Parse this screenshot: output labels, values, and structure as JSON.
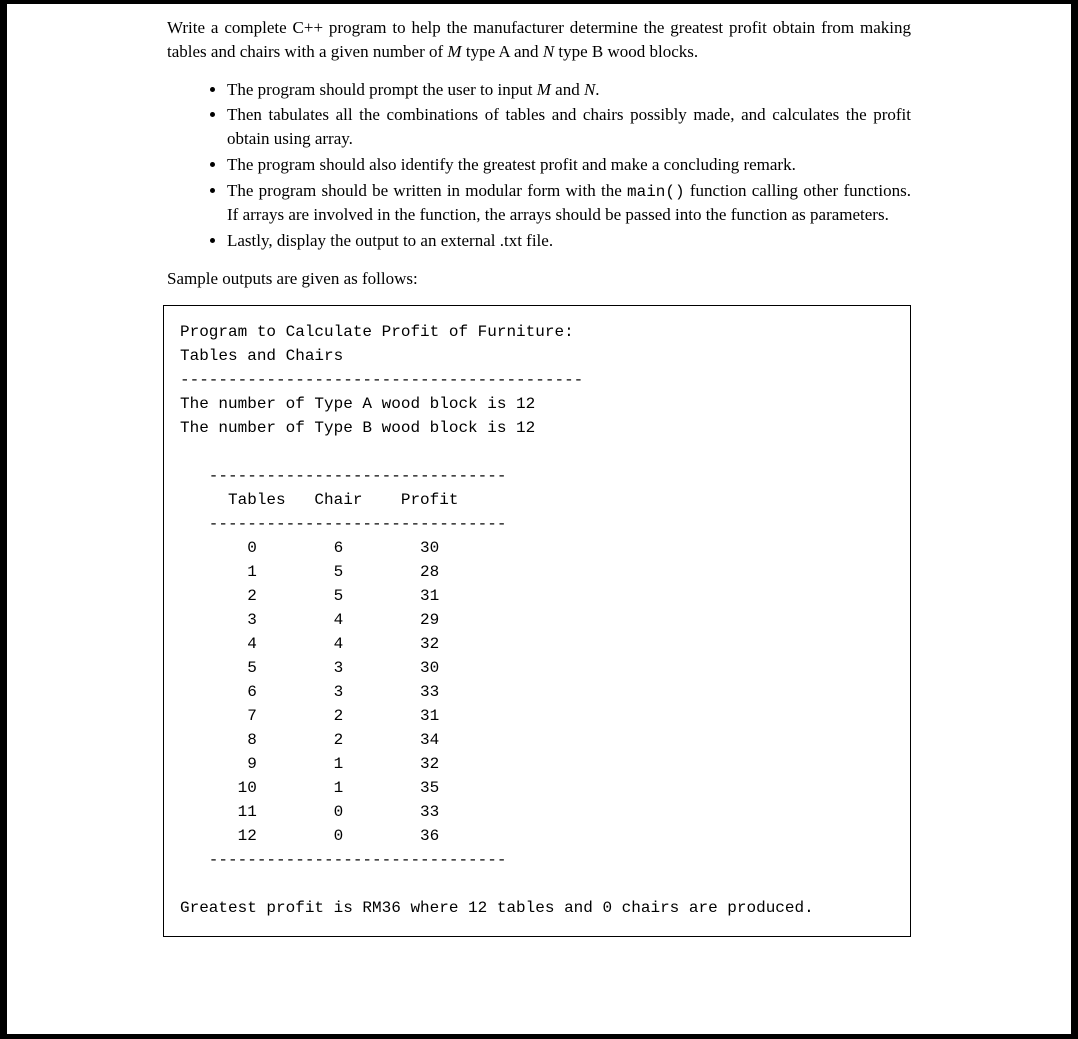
{
  "intro": "Write a complete C++ program to help the manufacturer determine the greatest profit obtain from making tables and chairs with a given number of ",
  "intro_m": "M",
  "intro_mid": " type A and ",
  "intro_n": "N",
  "intro_end": " type B wood blocks.",
  "bullets": {
    "b1a": "The program should prompt the user to input ",
    "b1m": "M",
    "b1mid": " and ",
    "b1n": "N",
    "b1end": ".",
    "b2": "Then tabulates all the combinations of tables and chairs possibly made, and calculates the profit obtain using array.",
    "b3": "The program should also identify the greatest profit and make a concluding remark.",
    "b4a": "The program should be written in modular form with the ",
    "b4code": "main()",
    "b4b": " function calling other functions. If arrays are involved in the function, the arrays should be passed into the function as parameters.",
    "b5": "Lastly, display the output to an external .txt file."
  },
  "sample_label": "Sample outputs are given as follows:",
  "output": {
    "title1": "Program to Calculate Profit of Furniture:",
    "title2": "Tables and Chairs",
    "dash1": "------------------------------------------",
    "typeA": "The number of Type A wood block is 12",
    "typeB": "The number of Type B wood block is 12",
    "dash2": "   -------------------------------",
    "header": "     Tables   Chair    Profit",
    "dash3": "   -------------------------------",
    "rows": [
      "       0        6        30",
      "       1        5        28",
      "       2        5        31",
      "       3        4        29",
      "       4        4        32",
      "       5        3        30",
      "       6        3        33",
      "       7        2        31",
      "       8        2        34",
      "       9        1        32",
      "      10        1        35",
      "      11        0        33",
      "      12        0        36"
    ],
    "dash4": "   -------------------------------",
    "conclusion": "Greatest profit is RM36 where 12 tables and 0 chairs are produced."
  },
  "chart_data": {
    "type": "table",
    "columns": [
      "Tables",
      "Chair",
      "Profit"
    ],
    "rows": [
      [
        0,
        6,
        30
      ],
      [
        1,
        5,
        28
      ],
      [
        2,
        5,
        31
      ],
      [
        3,
        4,
        29
      ],
      [
        4,
        4,
        32
      ],
      [
        5,
        3,
        30
      ],
      [
        6,
        3,
        33
      ],
      [
        7,
        2,
        31
      ],
      [
        8,
        2,
        34
      ],
      [
        9,
        1,
        32
      ],
      [
        10,
        1,
        35
      ],
      [
        11,
        0,
        33
      ],
      [
        12,
        0,
        36
      ]
    ],
    "inputs": {
      "M_typeA": 12,
      "N_typeB": 12
    },
    "greatest": {
      "profit": 36,
      "tables": 12,
      "chairs": 0,
      "currency": "RM"
    }
  }
}
